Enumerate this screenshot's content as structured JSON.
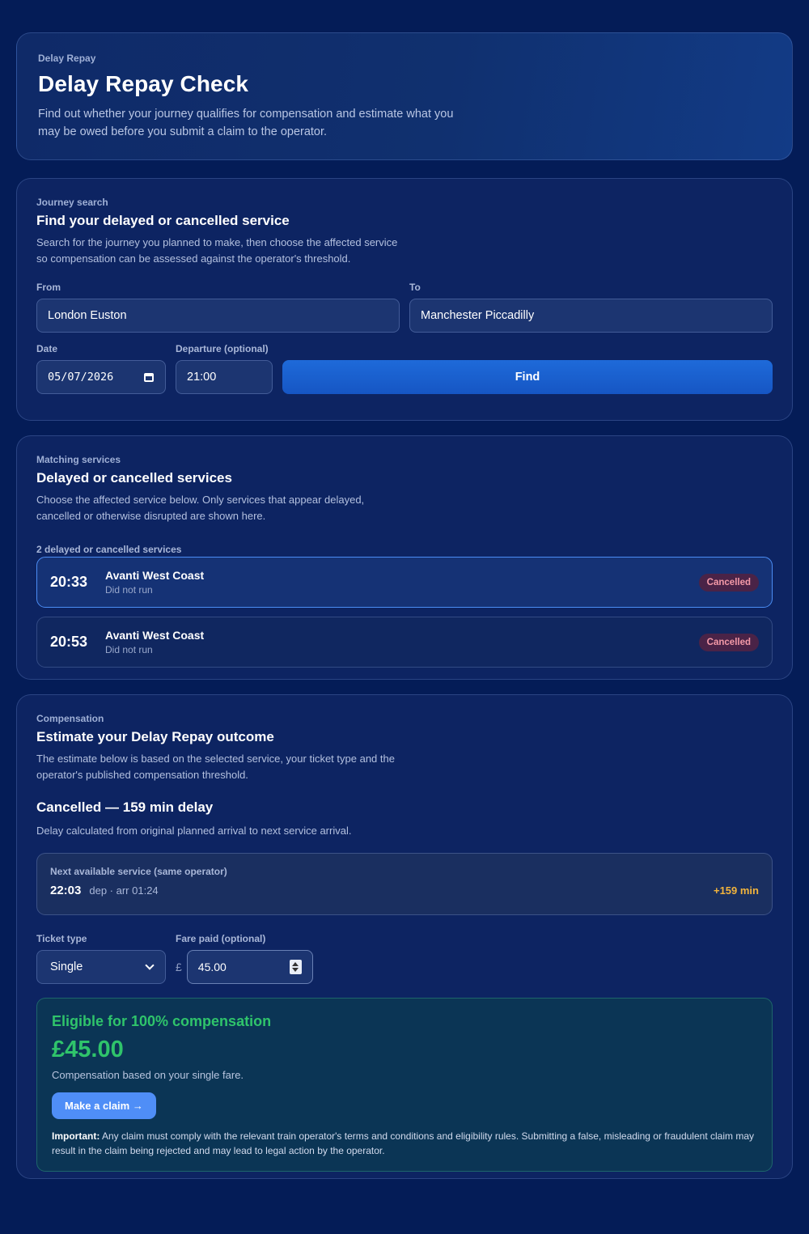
{
  "header": {
    "eyebrow": "Delay Repay",
    "title": "Delay Repay Check",
    "description": "Find out whether your journey qualifies for compensation and estimate what you may be owed before you submit a claim to the operator."
  },
  "search": {
    "eyebrow": "Journey search",
    "title": "Find your delayed or cancelled service",
    "description": "Search for the journey you planned to make, then choose the affected service so compensation can be assessed against the operator's threshold.",
    "from_label": "From",
    "from_value": "London Euston",
    "to_label": "To",
    "to_value": "Manchester Piccadilly",
    "date_label": "Date",
    "date_value": "05/07/2026",
    "departure_label": "Departure (optional)",
    "departure_value": "21:00",
    "find_label": "Find"
  },
  "services": {
    "eyebrow": "Matching services",
    "title": "Delayed or cancelled services",
    "description": "Choose the affected service below. Only services that appear delayed, cancelled or otherwise disrupted are shown here.",
    "count_label": "2 delayed or cancelled services",
    "items": [
      {
        "time": "20:33",
        "operator": "Avanti West Coast",
        "status_text": "Did not run",
        "badge": "Cancelled",
        "selected": true
      },
      {
        "time": "20:53",
        "operator": "Avanti West Coast",
        "status_text": "Did not run",
        "badge": "Cancelled",
        "selected": false
      }
    ]
  },
  "compensation": {
    "eyebrow": "Compensation",
    "title": "Estimate your Delay Repay outcome",
    "description": "The estimate below is based on the selected service, your ticket type and the operator's published compensation threshold.",
    "outcome_title": "Cancelled — 159 min delay",
    "outcome_desc": "Delay calculated from original planned arrival to next service arrival.",
    "next_label": "Next available service (same operator)",
    "next_time": "22:03",
    "next_sub": "dep · arr 01:24",
    "next_delay": "+159 min",
    "ticket_label": "Ticket type",
    "ticket_value": "Single",
    "fare_label": "Fare paid (optional)",
    "currency": "£",
    "fare_value": "45.00",
    "eligible_text": "Eligible for 100% compensation",
    "amount": "£45.00",
    "basis": "Compensation based on your single fare.",
    "claim_label": "Make a claim →",
    "important_label": "Important:",
    "important_text": "Any claim must comply with the relevant train operator's terms and conditions and eligibility rules. Submitting a false, misleading or fraudulent claim may result in the claim being rejected and may lead to legal action by the operator."
  },
  "colors": {
    "background": "#041c57",
    "accent": "#1e6ad9",
    "success": "#2fc46b",
    "warning": "#f2b43c",
    "danger": "#f59aa8"
  },
  "icons": [
    "calendar-icon",
    "chevron-down-icon",
    "number-spinner-icon"
  ]
}
